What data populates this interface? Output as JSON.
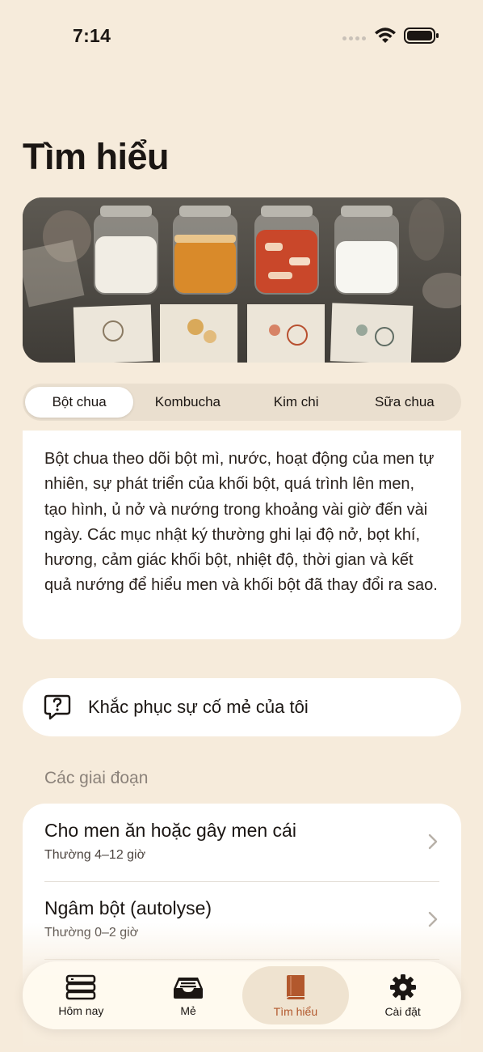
{
  "status_bar": {
    "time": "7:14"
  },
  "page": {
    "title": "Tìm hiểu"
  },
  "segments": [
    {
      "label": "Bột chua",
      "active": true
    },
    {
      "label": "Kombucha",
      "active": false
    },
    {
      "label": "Kim chi",
      "active": false
    },
    {
      "label": "Sữa chua",
      "active": false
    }
  ],
  "description": "Bột chua theo dõi bột mì, nước, hoạt động của men tự nhiên, sự phát triển của khối bột, quá trình lên men, tạo hình, ủ nở và nướng trong khoảng vài giờ đến vài ngày. Các mục nhật ký thường ghi lại độ nở, bọt khí, hương, cảm giác khối bột, nhiệt độ, thời gian và kết quả nướng để hiểu men và khối bột đã thay đổi ra sao.",
  "troubleshoot": {
    "label": "Khắc phục sự cố mẻ của tôi",
    "icon": "question-bubble-icon"
  },
  "stages_section": {
    "title": "Các giai đoạn",
    "items": [
      {
        "title": "Cho men ăn hoặc gây men cái",
        "subtitle": "Thường 4–12 giờ"
      },
      {
        "title": "Ngâm bột (autolyse)",
        "subtitle": "Thường 0–2 giờ"
      }
    ]
  },
  "tab_bar": {
    "items": [
      {
        "label": "Hôm nay",
        "icon": "today-list-icon",
        "active": false
      },
      {
        "label": "Mẻ",
        "icon": "tray-icon",
        "active": false
      },
      {
        "label": "Tìm hiểu",
        "icon": "book-icon",
        "active": true
      },
      {
        "label": "Cài đặt",
        "icon": "gear-icon",
        "active": false
      }
    ]
  },
  "colors": {
    "background": "#f6ebdb",
    "accent": "#b2582d",
    "card": "#ffffff",
    "muted": "#8b827a"
  }
}
